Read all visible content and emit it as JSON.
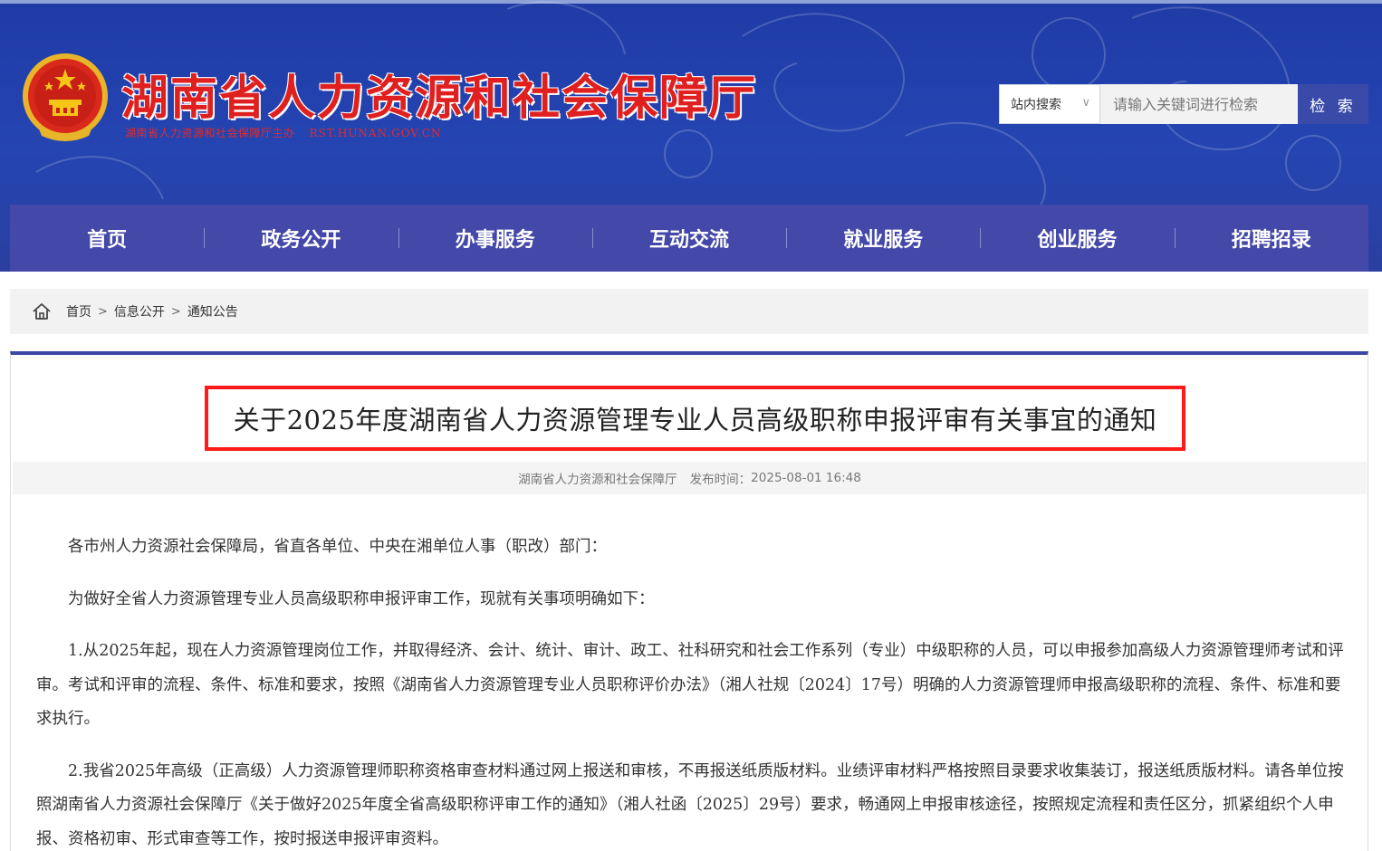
{
  "header": {
    "site_title": "湖南省人力资源和社会保障厅",
    "site_subtitle": "湖南省人力资源和社会保障厅主办",
    "site_domain": "RST.HUNAN.GOV.CN",
    "search": {
      "scope_selected": "站内搜索",
      "placeholder": "请输入关键词进行检索",
      "button_label": "检 索"
    }
  },
  "nav": {
    "items": [
      {
        "label": "首页"
      },
      {
        "label": "政务公开"
      },
      {
        "label": "办事服务"
      },
      {
        "label": "互动交流"
      },
      {
        "label": "就业服务"
      },
      {
        "label": "创业服务"
      },
      {
        "label": "招聘招录"
      }
    ]
  },
  "breadcrumb": {
    "items": [
      "首页",
      "信息公开",
      "通知公告"
    ],
    "separator": ">"
  },
  "article": {
    "title": "关于2025年度湖南省人力资源管理专业人员高级职称申报评审有关事宜的通知",
    "publisher": "湖南省人力资源和社会保障厅",
    "publish_label": "发布时间：",
    "publish_time": "2025-08-01 16:48",
    "paragraphs": [
      "各市州人力资源社会保障局，省直各单位、中央在湘单位人事（职改）部门：",
      "为做好全省人力资源管理专业人员高级职称申报评审工作，现就有关事项明确如下：",
      "1.从2025年起，现在人力资源管理岗位工作，并取得经济、会计、统计、审计、政工、社科研究和社会工作系列（专业）中级职称的人员，可以申报参加高级人力资源管理师考试和评审。考试和评审的流程、条件、标准和要求，按照《湖南省人力资源管理专业人员职称评价办法》（湘人社规〔2024〕17号）明确的人力资源管理师申报高级职称的流程、条件、标准和要求执行。",
      "2.我省2025年高级（正高级）人力资源管理师职称资格审查材料通过网上报送和审核，不再报送纸质版材料。业绩评审材料严格按照目录要求收集装订，报送纸质版材料。请各单位按照湖南省人力资源社会保障厅《关于做好2025年度全省高级职称评审工作的通知》（湘人社函〔2025〕29号）要求，畅通网上申报审核途径，按照规定流程和责任区分，抓紧组织个人申报、资格初审、形式审查等工作，按时报送申报评审资料。"
    ]
  },
  "colors": {
    "banner": "#2545b2",
    "nav": "#4448a8",
    "title_highlight": "#ff1a1a",
    "search_button": "#3a4aa8"
  }
}
